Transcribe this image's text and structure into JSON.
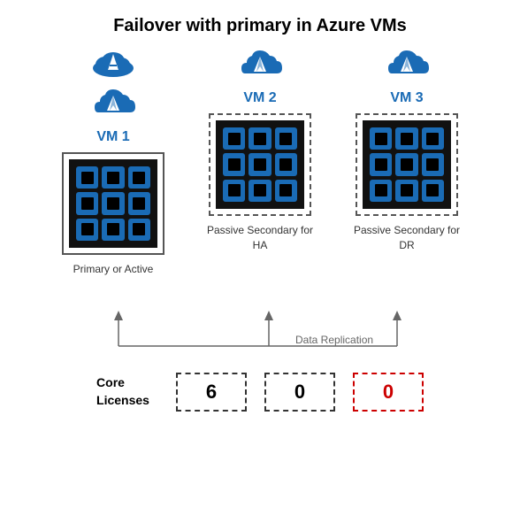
{
  "title": "Failover with primary in Azure VMs",
  "vms": [
    {
      "id": "vm1",
      "label": "VM 1",
      "border": "solid",
      "description": "Primary or Active",
      "chips": 9
    },
    {
      "id": "vm2",
      "label": "VM 2",
      "border": "dashed",
      "description": "Passive Secondary for HA",
      "chips": 9
    },
    {
      "id": "vm3",
      "label": "VM 3",
      "border": "dashed",
      "description": "Passive Secondary for DR",
      "chips": 9
    }
  ],
  "replication_label": "Data Replication",
  "licenses": [
    {
      "id": "lic1",
      "value": "6",
      "style": "dashed-black"
    },
    {
      "id": "lic2",
      "value": "0",
      "style": "dashed-black"
    },
    {
      "id": "lic3",
      "value": "0",
      "style": "dashed-red"
    }
  ],
  "license_label_line1": "Core",
  "license_label_line2": "Licenses"
}
